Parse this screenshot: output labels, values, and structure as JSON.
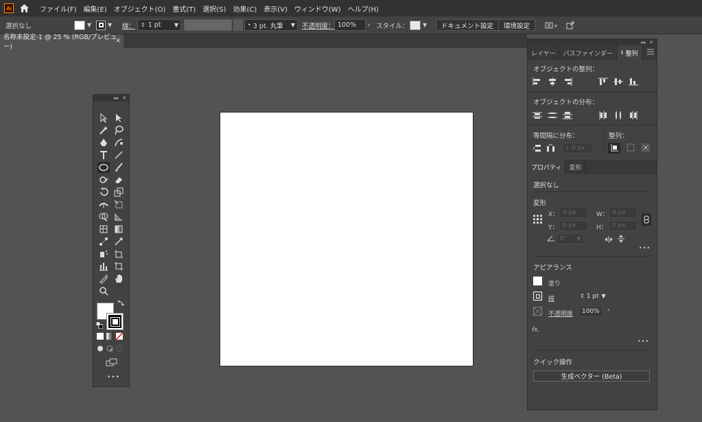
{
  "app": {
    "logo": "Ai"
  },
  "menus": [
    "ファイル(F)",
    "編集(E)",
    "オブジェクト(O)",
    "書式(T)",
    "選択(S)",
    "効果(C)",
    "表示(V)",
    "ウィンドウ(W)",
    "ヘルプ(H)"
  ],
  "control": {
    "selection": "選択なし",
    "stroke_label": "線：",
    "stroke_weight": "1 pt",
    "brush": "3 pt. 丸筆",
    "opacity_label": "不透明度：",
    "opacity": "100%",
    "style_label": "スタイル：",
    "doc_setup": "ドキュメント設定",
    "prefs": "環境設定"
  },
  "tab": {
    "title": "名称未設定-1 @ 25 % (RGB/プレビュー)",
    "close": "×"
  },
  "panel": {
    "tabs": [
      "レイヤー",
      "パスファインダー",
      "整列"
    ],
    "align_objects": "オブジェクトの整列：",
    "distribute_objects": "オブジェクトの分布：",
    "distribute_spacing": "等間隔に分布：",
    "align_to": "整列：",
    "spacing_value": "0 px",
    "sub_tabs": [
      "プロパティ",
      "変形"
    ],
    "no_selection": "選択なし",
    "transform": "変形",
    "x_label": "X：",
    "x_value": "0 px",
    "y_label": "Y：",
    "y_value": "0 px",
    "w_label": "W：",
    "w_value": "0 px",
    "h_label": "H：",
    "h_value": "0 px",
    "angle_value": "0°",
    "appearance": "アピアランス",
    "fill": "塗り",
    "stroke": "線",
    "stroke_weight": "1 pt",
    "opacity_label": "不透明度",
    "opacity": "100%",
    "fx": "fx.",
    "quick_actions": "クイック操作",
    "generate_vector": "生成ベクター (Beta)",
    "more": "•••"
  }
}
